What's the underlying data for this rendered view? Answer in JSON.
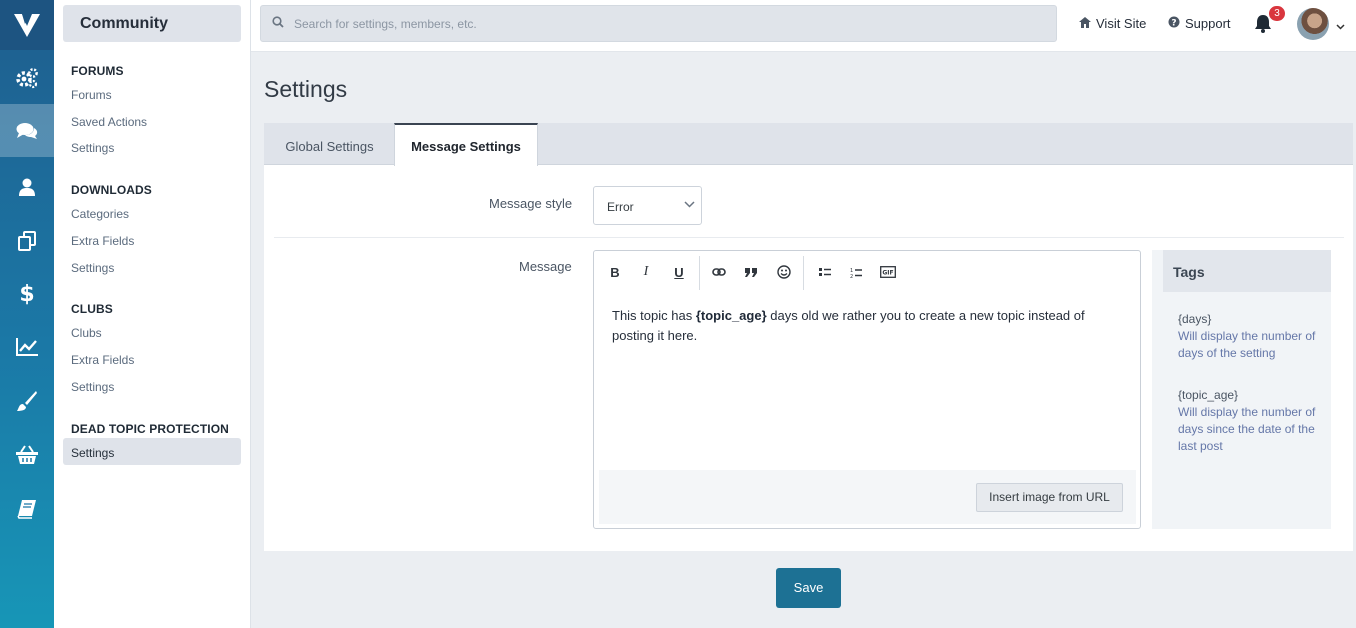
{
  "colors": {
    "accent": "#1d7194",
    "rail": "#1b78a6",
    "badge": "#d9363e"
  },
  "rail": {
    "icons": [
      "logo-icon",
      "cogs-icon",
      "comments-icon",
      "user-icon",
      "copy-icon",
      "dollar-icon",
      "line-chart-icon",
      "brush-icon",
      "shopping-basket-icon",
      "book-icon"
    ],
    "active": "comments-icon"
  },
  "sidebar": {
    "app_title": "Community",
    "sections": [
      {
        "title": "FORUMS",
        "items": [
          "Forums",
          "Saved Actions",
          "Settings"
        ]
      },
      {
        "title": "DOWNLOADS",
        "items": [
          "Categories",
          "Extra Fields",
          "Settings"
        ]
      },
      {
        "title": "CLUBS",
        "items": [
          "Clubs",
          "Extra Fields",
          "Settings"
        ]
      },
      {
        "title": "DEAD TOPIC PROTECTION",
        "items": [
          "Settings"
        ]
      }
    ],
    "active_item": "Settings"
  },
  "topbar": {
    "search_placeholder": "Search for settings, members, etc.",
    "visit_site": "Visit Site",
    "support": "Support",
    "notification_count": "3"
  },
  "page": {
    "title": "Settings",
    "tabs": [
      {
        "label": "Global Settings"
      },
      {
        "label": "Message Settings"
      }
    ],
    "active_tab": "Message Settings"
  },
  "form": {
    "message_style_label": "Message style",
    "message_style_value": "Error",
    "message_label": "Message",
    "message_before": "This topic has ",
    "message_tag": "{topic_age}",
    "message_after": " days old we rather you to create a new topic instead of posting it here.",
    "insert_image_label": "Insert image from URL",
    "save_label": "Save"
  },
  "toolbar": {
    "bold": "B",
    "italic": "I",
    "underline": "U",
    "icons": [
      "link-icon",
      "quote-icon",
      "emoji-icon",
      "bulleted-list-icon",
      "numbered-list-icon",
      "gif-icon"
    ]
  },
  "tags": {
    "title": "Tags",
    "items": [
      {
        "name": "{days}",
        "description": "Will display the number of days of the setting"
      },
      {
        "name": "{topic_age}",
        "description": "Will display the number of days since the date of the last post"
      }
    ]
  }
}
